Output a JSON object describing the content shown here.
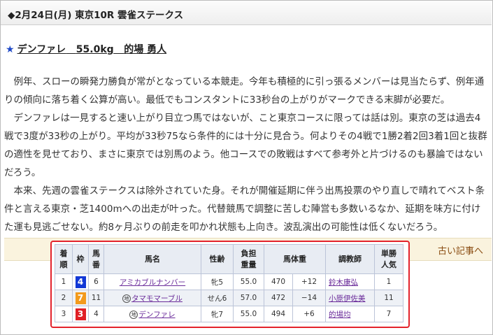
{
  "race": {
    "title": "◆2月24日(月) 東京10R 雲雀ステークス"
  },
  "pick": {
    "star": "★",
    "horse": "デンファレ",
    "weight": "55.0kg",
    "jockey": "的場 勇人"
  },
  "article": {
    "lines": [
      "例年、スローの瞬発力勝負が常がとなっている本競走。今年も積極的に引っ張るメンバーは見当たらず、例年通",
      "りの傾向に落ち着く公算が高い。最低でもコンスタントに33秒台の上がりがマークできる末脚が必要だ。",
      "デンファレは一見すると速い上がり目立つ馬ではないが、こと東京コースに限っては話は別。東京の芝は過去4",
      "戦で3度が33秒の上がり。平均が33秒75なら条件的には十分に見合う。何よりその4戦で1勝2着2回3着1回と抜群",
      "の適性を見せており、まさに東京では別馬のよう。他コースでの敗戦はすべて参考外と片づけるのも暴論ではない",
      "だろう。",
      "本来、先週の雲雀ステークスは除外されていた身。それが開催延期に伴う出馬投票のやり直しで晴れてベスト条",
      "件と言える東京・芝1400mへの出走が叶った。代替競馬で調整に苦しむ陣営も多数いるなか、延期を味方に付け",
      "た運も見逃ごせない。約8ヶ月ぶりの前走を叩かれ状態も上向き。波乱演出の可能性は低くないだろう。"
    ]
  },
  "old_articles_link": "古い記事へ",
  "results": {
    "headers": {
      "rank": [
        "着",
        "順"
      ],
      "waku": "枠",
      "umaban": [
        "馬",
        "番"
      ],
      "name": "馬名",
      "sex_age": "性齢",
      "weight": [
        "負担",
        "重量"
      ],
      "body_weight": "馬体重",
      "trainer": "調教師",
      "popularity": [
        "単勝",
        "人気"
      ]
    },
    "rows": [
      {
        "rank": "1",
        "waku": "4",
        "waku_bg": "#1238d6",
        "waku_fg": "#ffffff",
        "umaban": "6",
        "ext": "",
        "name": "アミカブルナンバー",
        "sex_age": "牝5",
        "weight": "55.0",
        "body": "470",
        "diff": "+12",
        "trainer": "鈴木康弘",
        "pop": "1"
      },
      {
        "rank": "2",
        "waku": "7",
        "waku_bg": "#f39a1c",
        "waku_fg": "#ffffff",
        "umaban": "11",
        "ext": "地",
        "name": "タマモマーブル",
        "sex_age": "せん6",
        "weight": "57.0",
        "body": "472",
        "diff": "−14",
        "trainer": "小原伊佐美",
        "pop": "11"
      },
      {
        "rank": "3",
        "waku": "3",
        "waku_bg": "#e01f26",
        "waku_fg": "#ffffff",
        "umaban": "4",
        "ext": "地",
        "name": "デンファレ",
        "sex_age": "牝7",
        "weight": "55.0",
        "body": "494",
        "diff": "+6",
        "trainer": "的場均",
        "pop": "7"
      }
    ]
  }
}
